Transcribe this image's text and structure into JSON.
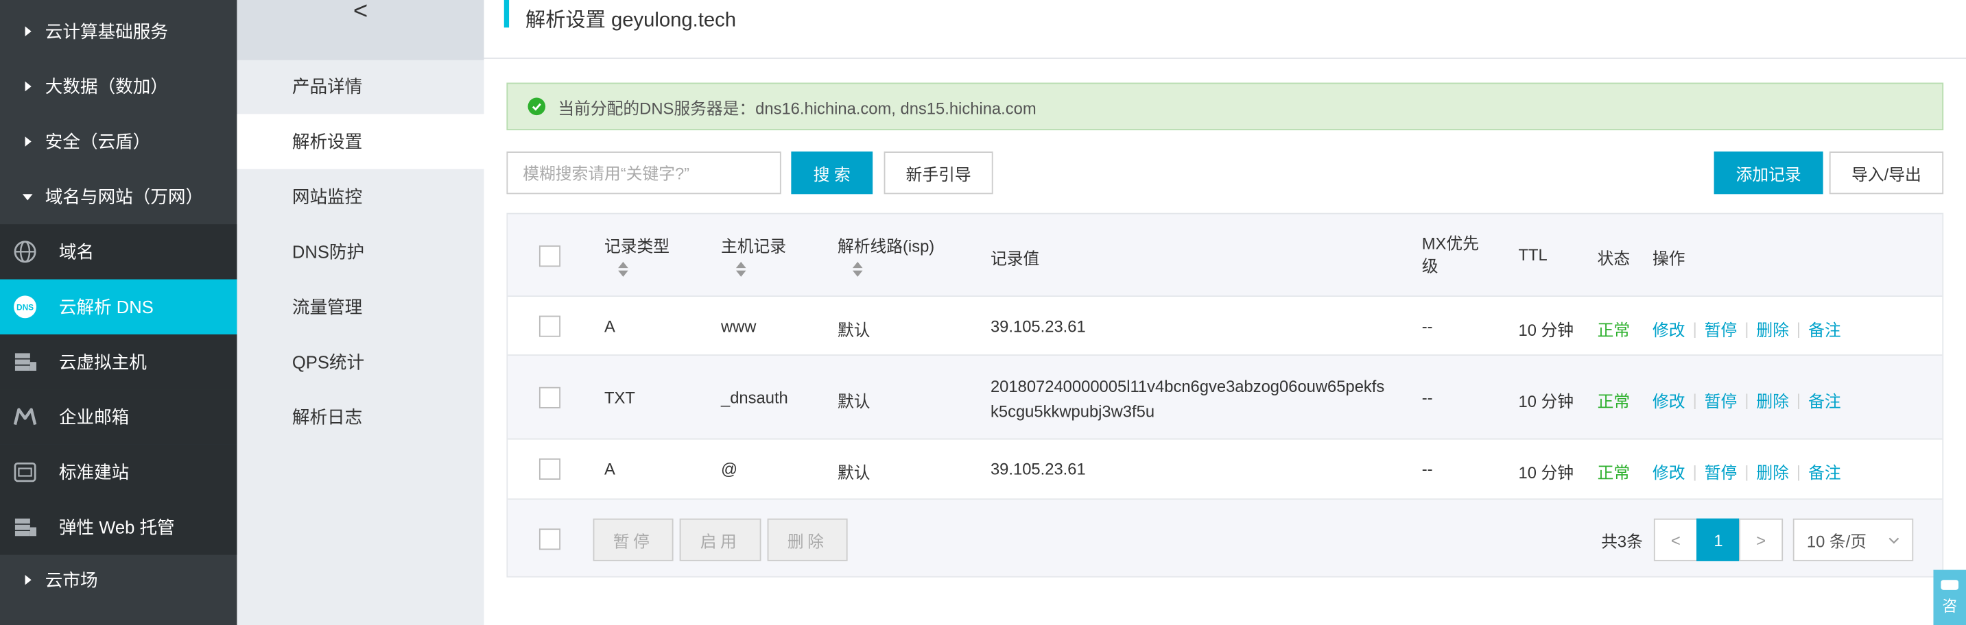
{
  "sidebar": {
    "categories": [
      {
        "label": "云计算基础服务",
        "expanded": false
      },
      {
        "label": "大数据（数加）",
        "expanded": false
      },
      {
        "label": "安全（云盾）",
        "expanded": false
      },
      {
        "label": "域名与网站（万网）",
        "expanded": true
      }
    ],
    "sub_items": [
      {
        "label": "域名",
        "icon": "globe-icon"
      },
      {
        "label": "云解析 DNS",
        "icon": "dns-icon",
        "active": true
      },
      {
        "label": "云虚拟主机",
        "icon": "server-icon"
      },
      {
        "label": "企业邮箱",
        "icon": "mail-icon"
      },
      {
        "label": "标准建站",
        "icon": "website-icon"
      },
      {
        "label": "弹性 Web 托管",
        "icon": "server-icon"
      }
    ],
    "bottom_category": {
      "label": "云市场",
      "expanded": false
    }
  },
  "subnav": {
    "collapse_glyph": "<",
    "items": [
      "产品详情",
      "解析设置",
      "网站监控",
      "DNS防护",
      "流量管理",
      "QPS统计",
      "解析日志"
    ],
    "active_index": 1
  },
  "main": {
    "title": "解析设置 geyulong.tech",
    "notice": "当前分配的DNS服务器是：dns16.hichina.com, dns15.hichina.com",
    "search": {
      "placeholder": "模糊搜索请用“关键字?”"
    },
    "search_button": "搜 索",
    "guide_button": "新手引导",
    "add_button": "添加记录",
    "import_export_button": "导入/导出"
  },
  "table": {
    "headers": {
      "type": "记录类型",
      "host": "主机记录",
      "line": "解析线路(isp)",
      "value": "记录值",
      "mx_line1": "MX优先",
      "mx_line2": "级",
      "ttl": "TTL",
      "status": "状态",
      "ops": "操作"
    },
    "rows": [
      {
        "type": "A",
        "host": "www",
        "line": "默认",
        "value1": "39.105.23.61",
        "value2": "",
        "mx": "--",
        "ttl": "10 分钟",
        "status": "正常"
      },
      {
        "type": "TXT",
        "host": "_dnsauth",
        "line": "默认",
        "value1": "201807240000005l11v4bcn6gve3abzog06ouw65pekfs",
        "value2": "k5cgu5kkwpubj3w3f5u",
        "mx": "--",
        "ttl": "10 分钟",
        "status": "正常"
      },
      {
        "type": "A",
        "host": "@",
        "line": "默认",
        "value1": "39.105.23.61",
        "value2": "",
        "mx": "--",
        "ttl": "10 分钟",
        "status": "正常"
      }
    ],
    "actions": {
      "edit": "修改",
      "pause": "暂停",
      "delete": "删除",
      "note": "备注"
    },
    "footer": {
      "pause": "暂停",
      "enable": "启用",
      "delete": "删除",
      "total": "共3条",
      "prev": "<",
      "page": "1",
      "next": ">",
      "page_size": "10 条/页"
    }
  },
  "chat_widget": {
    "label": "咨"
  },
  "colors": {
    "accent": "#00a2ca",
    "sidebar_active": "#00c1de",
    "sidebar_bg": "#373d41",
    "ok": "#2eb02e"
  }
}
